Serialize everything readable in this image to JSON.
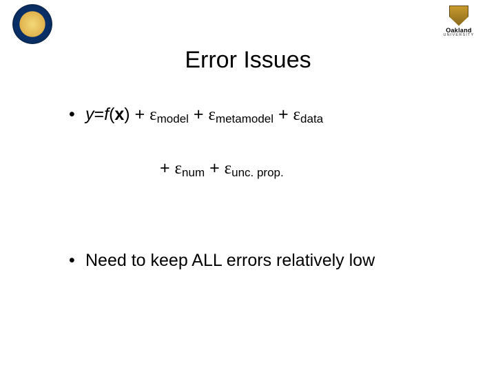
{
  "title": "Error Issues",
  "logos": {
    "left_alt": "university-seal",
    "right_name": "Oakland",
    "right_sub": "UNIVERSITY"
  },
  "equation": {
    "lhs_y": "y",
    "eq": "=",
    "f": "f",
    "lparen": "(",
    "x": "x",
    "rparen": ")",
    "plus": " + ",
    "epsilon": "ε",
    "sub_model": "model",
    "sub_metamodel": "metamodel",
    "sub_data": "data",
    "sub_num": "num",
    "sub_unc": "unc. prop."
  },
  "bullet2": "Need to keep ALL errors relatively low"
}
